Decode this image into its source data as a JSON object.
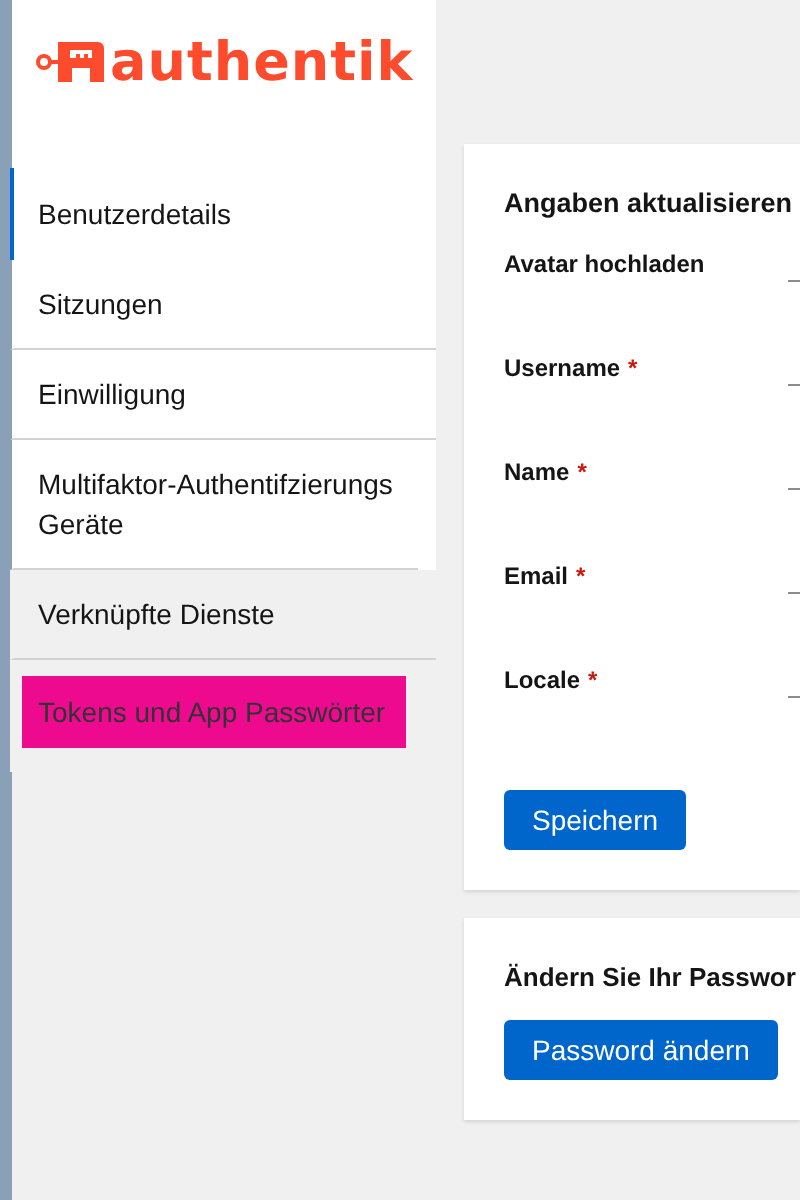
{
  "logo": {
    "text": "authentik"
  },
  "sidebar": {
    "items": [
      {
        "label": "Benutzerdetails",
        "selected": true,
        "highlighted": false
      },
      {
        "label": "Sitzungen",
        "selected": false,
        "highlighted": false
      },
      {
        "label": "Einwilligung",
        "selected": false,
        "highlighted": false
      },
      {
        "label": "Multifaktor-Authentifzierungs Geräte",
        "selected": false,
        "highlighted": false
      },
      {
        "label": "Verknüpfte Dienste",
        "selected": false,
        "highlighted": false
      },
      {
        "label": "Tokens und App Passwörter",
        "selected": false,
        "highlighted": true
      }
    ]
  },
  "details_card": {
    "title": "Angaben aktualisieren",
    "fields": [
      {
        "label": "Avatar hochladen"
      },
      {
        "label": "Username",
        "mark": "*"
      },
      {
        "label": "Name",
        "mark": "*"
      },
      {
        "label": "Email",
        "mark": "*"
      },
      {
        "label": "Locale",
        "mark": "*"
      }
    ],
    "button": "Speichern"
  },
  "password_card": {
    "title": "Ändern Sie Ihr Passwor",
    "button": "Password ändern"
  }
}
